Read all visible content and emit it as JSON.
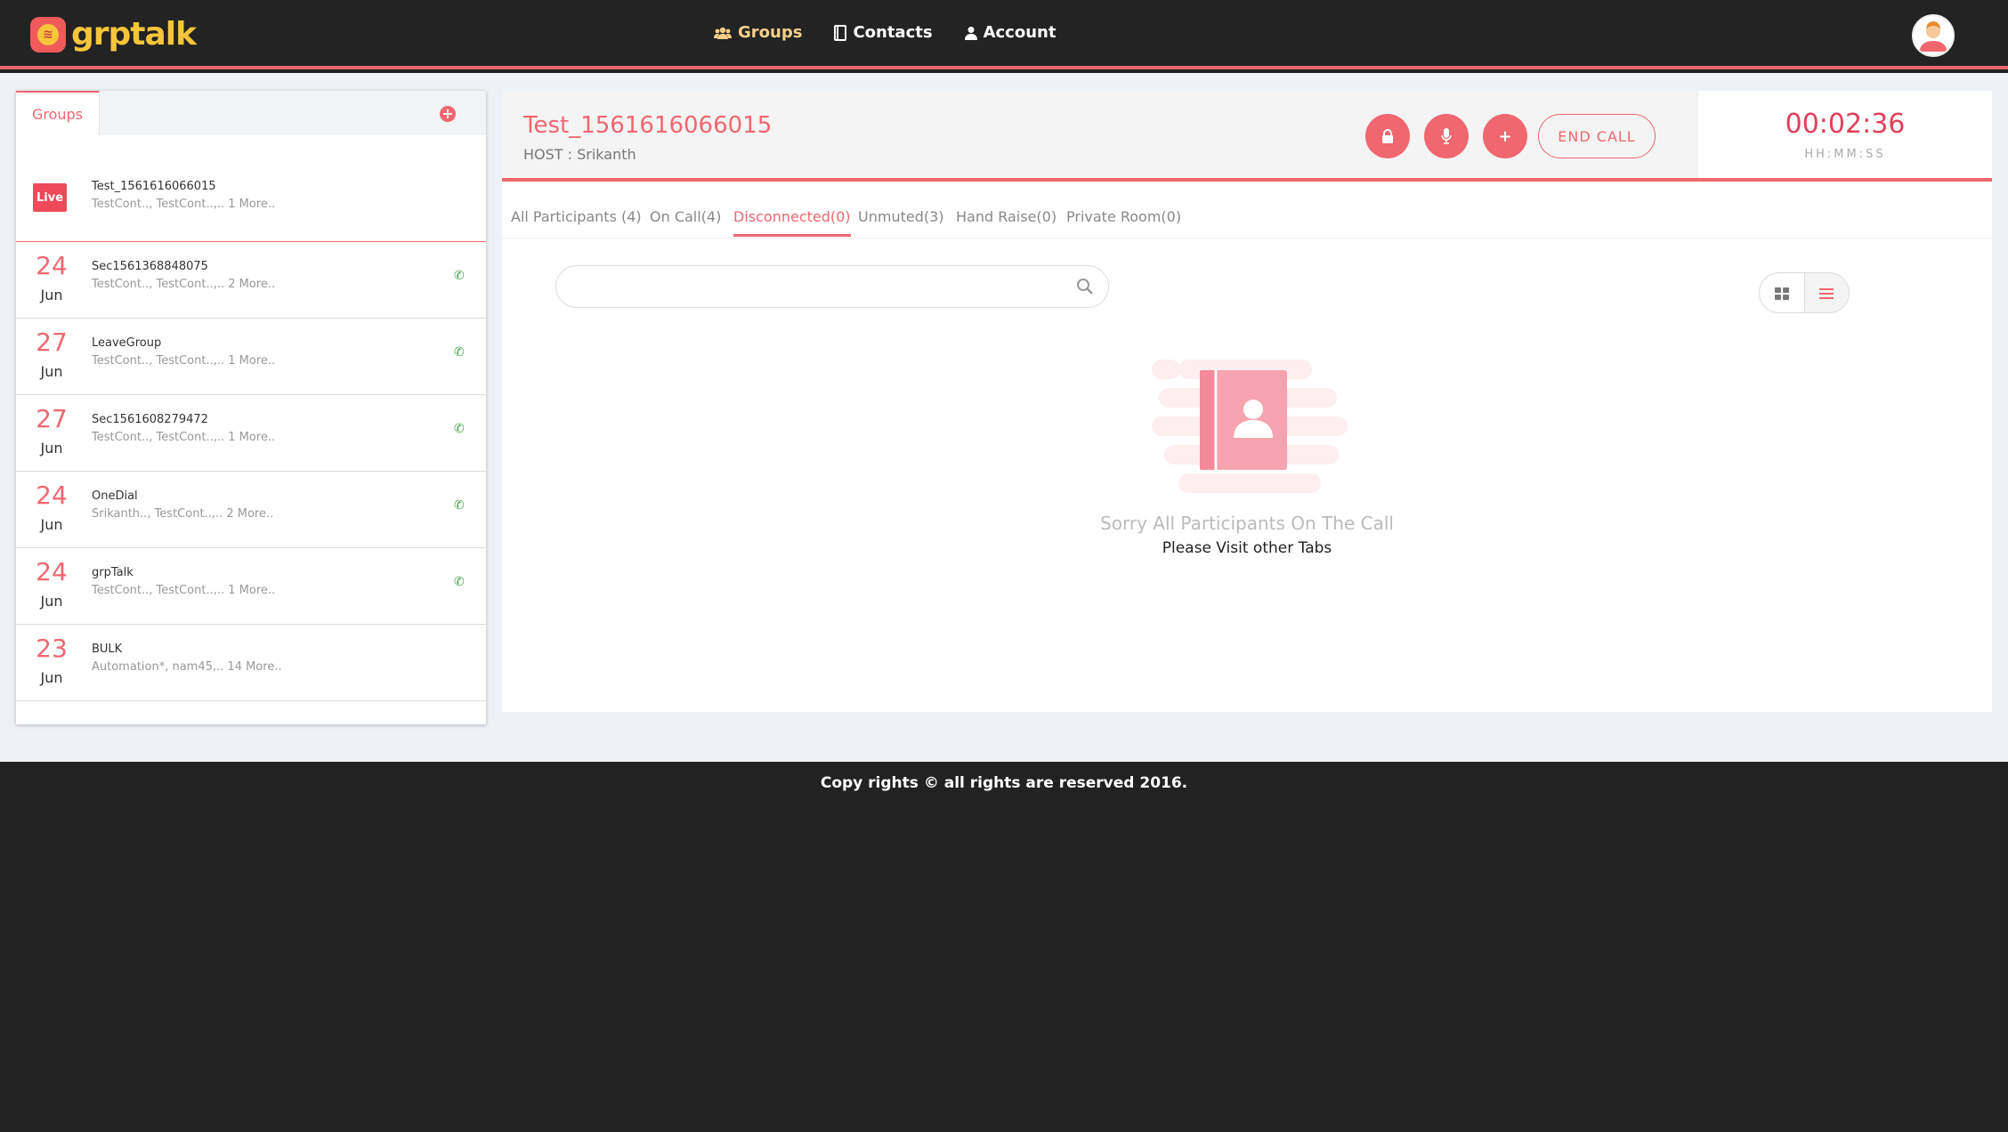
{
  "app": {
    "logo_text": "grptalk"
  },
  "nav": {
    "items": [
      {
        "label": "Groups",
        "icon": "users-icon"
      },
      {
        "label": "Contacts",
        "icon": "address-book-icon"
      },
      {
        "label": "Account",
        "icon": "user-icon"
      }
    ],
    "active": "Groups"
  },
  "sidebar": {
    "tab_label": "Groups",
    "groups": [
      {
        "status": "Live",
        "name": "Test_1561616066015",
        "members": "TestCont.., TestCont..,.. 1 More.."
      },
      {
        "day": "24",
        "month": "Jun",
        "name": "Sec1561368848075",
        "members": "TestCont.., TestCont..,.. 2 More.."
      },
      {
        "day": "27",
        "month": "Jun",
        "name": "LeaveGroup",
        "members": "TestCont.., TestCont..,.. 1 More.."
      },
      {
        "day": "27",
        "month": "Jun",
        "name": "Sec1561608279472",
        "members": "TestCont.., TestCont..,.. 1 More.."
      },
      {
        "day": "24",
        "month": "Jun",
        "name": "OneDial",
        "members": "Srikanth.., TestCont..,.. 2 More.."
      },
      {
        "day": "24",
        "month": "Jun",
        "name": "grpTalk",
        "members": "TestCont.., TestCont..,.. 1 More.."
      },
      {
        "day": "23",
        "month": "Jun",
        "name": "BULK",
        "members": "Automation*, nam45,.. 14 More.."
      }
    ]
  },
  "call": {
    "title": "Test_1561616066015",
    "host": "HOST : Srikanth",
    "end_call_label": "END CALL",
    "timer": "00:02:36",
    "timer_format": "HH:MM:SS"
  },
  "tabs": [
    {
      "label": "All Participants (4)"
    },
    {
      "label": "On Call(4)"
    },
    {
      "label": "Disconnected(0)"
    },
    {
      "label": "Unmuted(3)"
    },
    {
      "label": "Hand Raise(0)"
    },
    {
      "label": "Private Room(0)"
    }
  ],
  "active_tab": "Disconnected(0)",
  "empty_state": {
    "title": "Sorry All Participants On The Call",
    "subtitle": "Please Visit other Tabs"
  },
  "footer": {
    "text": "Copy rights © all rights are reserved 2016."
  },
  "colors": {
    "accent": "#f0676f",
    "brand_yellow": "#f7c53a",
    "dark": "#232323",
    "phone_green": "#43a047"
  }
}
